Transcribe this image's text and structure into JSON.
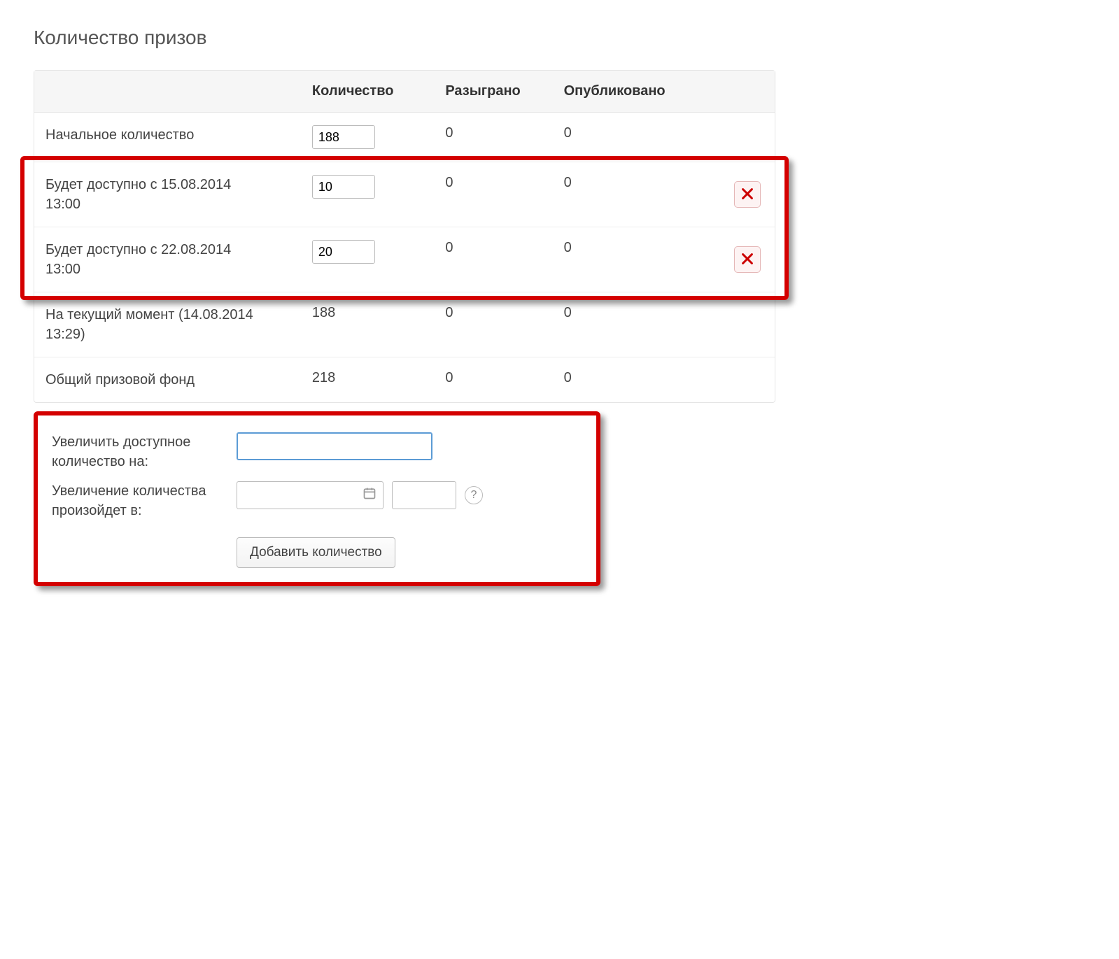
{
  "section_title": "Количество призов",
  "table": {
    "headers": {
      "label": "",
      "qty": "Количество",
      "drawn": "Разыграно",
      "published": "Опубликовано"
    },
    "rows": [
      {
        "label": "Начальное количество",
        "qty_value": "188",
        "qty_editable": true,
        "drawn": "0",
        "published": "0",
        "deletable": false,
        "highlighted": false
      },
      {
        "label": "Будет доступно с 15.08.2014 13:00",
        "qty_value": "10",
        "qty_editable": true,
        "drawn": "0",
        "published": "0",
        "deletable": true,
        "highlighted": true
      },
      {
        "label": "Будет доступно с 22.08.2014 13:00",
        "qty_value": "20",
        "qty_editable": true,
        "drawn": "0",
        "published": "0",
        "deletable": true,
        "highlighted": true
      },
      {
        "label": "На текущий момент (14.08.2014 13:29)",
        "qty_value": "188",
        "qty_editable": false,
        "drawn": "0",
        "published": "0",
        "deletable": false,
        "highlighted": false
      },
      {
        "label": "Общий призовой фонд",
        "qty_value": "218",
        "qty_editable": false,
        "drawn": "0",
        "published": "0",
        "deletable": false,
        "highlighted": false
      }
    ]
  },
  "form": {
    "increase_label": "Увеличить доступное количество на:",
    "increase_value": "",
    "schedule_label": "Увеличение количества произойдет в:",
    "schedule_date": "",
    "schedule_time": "",
    "help_glyph": "?",
    "submit_label": "Добавить количество"
  }
}
